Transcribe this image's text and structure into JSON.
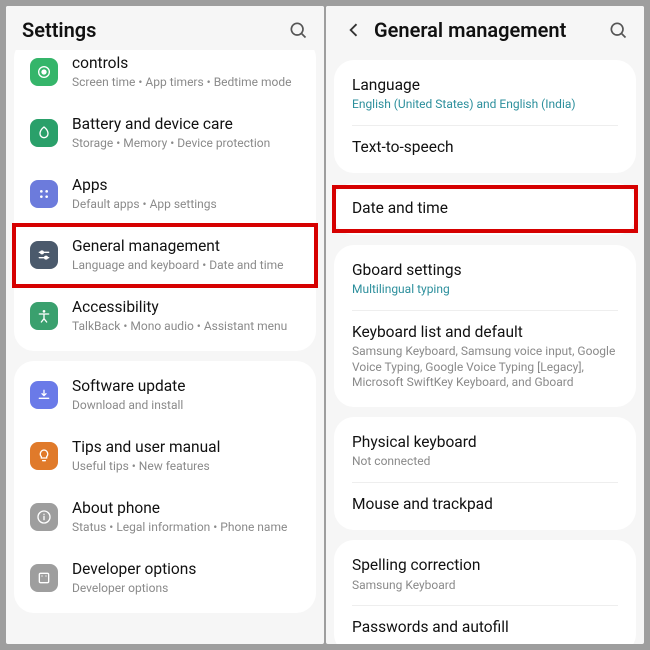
{
  "left": {
    "header_title": "Settings",
    "rows": [
      {
        "label": "controls",
        "sub": "Screen time  •  App timers  •  Bedtime mode",
        "icon": "wellbeing",
        "color": "#35b56a",
        "cut": true
      },
      {
        "label": "Battery and device care",
        "sub": "Storage  •  Memory  •  Device protection",
        "icon": "care",
        "color": "#2aa06a"
      },
      {
        "label": "Apps",
        "sub": "Default apps  •  App settings",
        "icon": "apps",
        "color": "#6c7bdc"
      },
      {
        "label": "General management",
        "sub": "Language and keyboard  •  Date and time",
        "icon": "sliders",
        "color": "#4b5a6c",
        "hl": true
      },
      {
        "label": "Accessibility",
        "sub": "TalkBack  •  Mono audio  •  Assistant menu",
        "icon": "a11y",
        "color": "#3aa06e"
      },
      {
        "label": "Software update",
        "sub": "Download and install",
        "icon": "update",
        "color": "#6a7ae8"
      },
      {
        "label": "Tips and user manual",
        "sub": "Useful tips  •  New features",
        "icon": "tips",
        "color": "#e07a2a"
      },
      {
        "label": "About phone",
        "sub": "Status  •  Legal information  •  Phone name",
        "icon": "info",
        "color": "#9e9e9e"
      },
      {
        "label": "Developer options",
        "sub": "Developer options",
        "icon": "dev",
        "color": "#9e9e9e"
      }
    ]
  },
  "right": {
    "header_title": "General management",
    "rows": [
      {
        "label": "Language",
        "sub": "English (United States) and English (India)",
        "acc": true
      },
      {
        "label": "Text-to-speech"
      },
      {
        "label": "Date and time",
        "hl": true
      },
      {
        "label": "Gboard settings",
        "sub": "Multilingual typing",
        "acc": true
      },
      {
        "label": "Keyboard list and default",
        "sub": "Samsung Keyboard, Samsung voice input, Google Voice Typing, Google Voice Typing [Legacy], Microsoft SwiftKey Keyboard, and Gboard"
      },
      {
        "label": "Physical keyboard",
        "sub": "Not connected"
      },
      {
        "label": "Mouse and trackpad"
      },
      {
        "label": "Spelling correction",
        "sub": "Samsung Keyboard"
      },
      {
        "label": "Passwords and autofill"
      }
    ],
    "groups": [
      [
        0,
        1
      ],
      [
        2
      ],
      [
        3,
        4
      ],
      [
        5,
        6
      ],
      [
        7,
        8
      ]
    ]
  }
}
